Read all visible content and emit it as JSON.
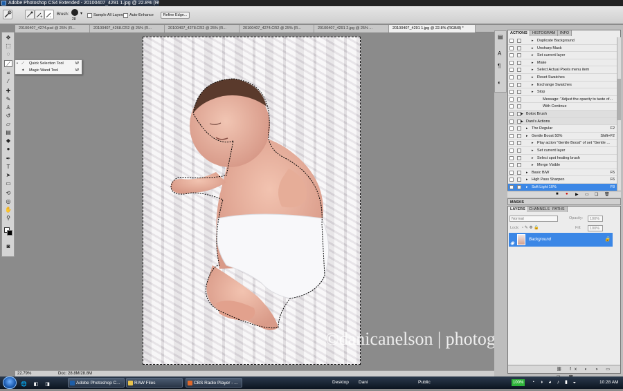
{
  "window": {
    "title": "Adobe Photoshop CS4 Extended - 20100407_4291 1.jpg @ 22.8% (RGB/8) *"
  },
  "options_bar": {
    "brush_label": "Brush:",
    "brush_size": "28",
    "sample_all_layers": "Sample All Layers",
    "auto_enhance": "Auto-Enhance",
    "refine_edge": "Refine Edge..."
  },
  "tabs": [
    {
      "label": "20100407_4274.psd @ 25% (R..."
    },
    {
      "label": "20100407_4268.CR2 @ 25% (R..."
    },
    {
      "label": "20100407_4278.CR2 @ 25% (R..."
    },
    {
      "label": "20100407_4274.CR2 @ 25% (R..."
    },
    {
      "label": "20100407_4291 2.jpg @ 25% ..."
    },
    {
      "label": "20100407_4291 1.jpg @ 22.8% (RGB/8) *"
    }
  ],
  "tool_flyout": [
    {
      "label": "Quick Selection Tool",
      "key": "W"
    },
    {
      "label": "Magic Wand Tool",
      "key": "W"
    }
  ],
  "status": {
    "zoom": "22.79%",
    "doc": "Doc: 28.8M/28.8M"
  },
  "watermark": "©danicanelson | photography",
  "actions_panel": {
    "tabs": [
      "ACTIONS",
      "HISTOGRAM",
      "INFO"
    ],
    "rows": [
      {
        "label": "Duplicate Background",
        "key": "",
        "level": 2
      },
      {
        "label": "Unsharp Mask",
        "key": "",
        "level": 2
      },
      {
        "label": "Set current layer",
        "key": "",
        "level": 2
      },
      {
        "label": "Make",
        "key": "",
        "level": 2
      },
      {
        "label": "Select Actual Pixels menu item",
        "key": "",
        "level": 2
      },
      {
        "label": "Reset Swatches",
        "key": "",
        "level": 2
      },
      {
        "label": "Exchange Swatches",
        "key": "",
        "level": 2
      },
      {
        "label": "Stop",
        "key": "",
        "level": 2
      },
      {
        "label": "Message: \"Adjust the opacity to taste of...",
        "key": "",
        "level": 3
      },
      {
        "label": "With Continue",
        "key": "",
        "level": 3
      },
      {
        "label": "Botox Brush",
        "key": "",
        "level": 0
      },
      {
        "label": "Dani's Actions",
        "key": "",
        "level": 0
      },
      {
        "label": "The Regular",
        "key": "F2",
        "level": 1
      },
      {
        "label": "Gentle Boost 50%",
        "key": "Shift+F2",
        "level": 1
      },
      {
        "label": "Play action \"Gentle Boost\" of set \"Gentle ...",
        "key": "",
        "level": 2
      },
      {
        "label": "Set current layer",
        "key": "",
        "level": 2
      },
      {
        "label": "Select spot healing brush",
        "key": "",
        "level": 2
      },
      {
        "label": "Merge Visible",
        "key": "",
        "level": 2
      },
      {
        "label": "Basic B/W",
        "key": "F5",
        "level": 1
      },
      {
        "label": "High Pass Sharpen",
        "key": "F6",
        "level": 1
      },
      {
        "label": "Soft Light 10%",
        "key": "F8",
        "level": 1
      }
    ]
  },
  "masks_panel": {
    "title": "MASKS"
  },
  "layers_panel": {
    "tabs": [
      "LAYERS",
      "CHANNELS",
      "PATHS"
    ],
    "blend_mode": "Normal",
    "opacity_label": "Opacity:",
    "opacity": "100%",
    "lock_label": "Lock:",
    "fill_label": "Fill:",
    "fill": "100%",
    "layer_name": "Background"
  },
  "taskbar": {
    "items": [
      {
        "label": "Adobe Photoshop C..."
      },
      {
        "label": "RAW Files"
      },
      {
        "label": "CBS Radio Player - ..."
      }
    ],
    "desktop": "Desktop",
    "dani": "Dani",
    "public": "Public",
    "battery": "100%",
    "clock": "10:28 AM"
  },
  "colors": {
    "selection_blue": "#3b87e6",
    "panel_bg": "#ececec",
    "canvas_bg": "#8b8b8b"
  }
}
